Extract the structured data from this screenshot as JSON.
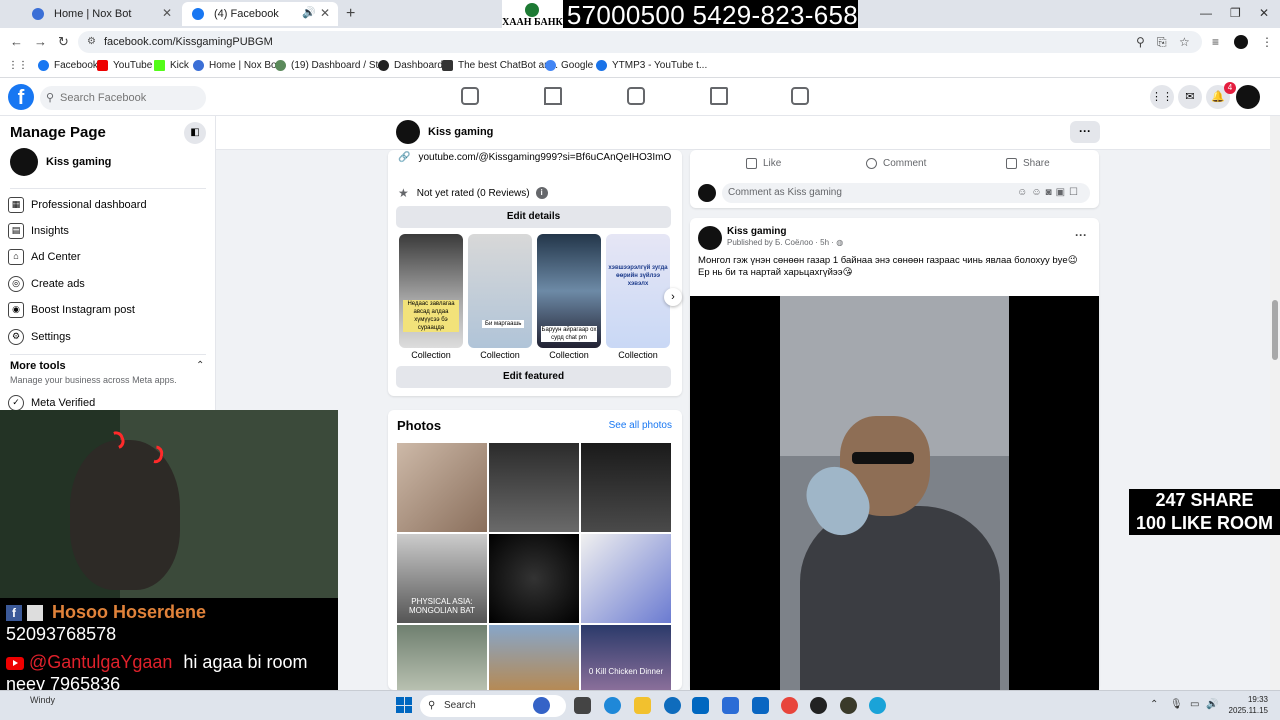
{
  "browser": {
    "tabs": [
      {
        "label": "Home | Nox Bot"
      },
      {
        "label": "(4) Facebook"
      }
    ],
    "url": "facebook.com/KissgamingPUBGM",
    "bookmarks": [
      {
        "label": "Facebook"
      },
      {
        "label": "YouTube"
      },
      {
        "label": "Kick"
      },
      {
        "label": "Home | Nox Bot"
      },
      {
        "label": "(19) Dashboard / Str..."
      },
      {
        "label": "Dashboard"
      },
      {
        "label": "The best ChatBot an..."
      },
      {
        "label": "Google"
      },
      {
        "label": "YTMP3 - YouTube t..."
      }
    ]
  },
  "bank_overlay": {
    "bank_name": "ХААН БАНК",
    "phones": "57000500 5429-823-658"
  },
  "fb": {
    "search_placeholder": "Search Facebook",
    "notification_count": "4"
  },
  "sidebar": {
    "title": "Manage Page",
    "page_name": "Kiss gaming",
    "items": [
      {
        "label": "Professional dashboard"
      },
      {
        "label": "Insights"
      },
      {
        "label": "Ad Center"
      },
      {
        "label": "Create ads"
      },
      {
        "label": "Boost Instagram post"
      },
      {
        "label": "Settings"
      }
    ],
    "more_tools": "More tools",
    "more_tools_sub": "Manage your business across Meta apps.",
    "meta_verified": "Meta Verified"
  },
  "page_header": {
    "name": "Kiss gaming"
  },
  "intro": {
    "link": "youtube.com/@Kissgaming999?si=Bf6uCAnQeIHO3ImO",
    "rating": "Not yet rated (0 Reviews)",
    "edit_details": "Edit details",
    "edit_featured": "Edit featured",
    "stories": [
      {
        "label": "Collection",
        "caption": "Недаас завлагаа авсад алдаа хүмүүсээ бэ сураацда"
      },
      {
        "label": "Collection",
        "caption": "Би маргаашь"
      },
      {
        "label": "Collection",
        "caption": "Баруун айрагаар ох сурд chat pm"
      },
      {
        "label": "Collection",
        "caption": "хэвшээрэлгүй зугда өөрийн зүйлээ хэвэлх"
      }
    ]
  },
  "photos": {
    "title": "Photos",
    "see_all": "See all photos",
    "captions": [
      "",
      "",
      "",
      "PHYSICAL ASIA: MONGOLIAN BAT",
      "",
      "",
      "",
      "",
      "0 Kill Chicken Dinner"
    ]
  },
  "post_actions": {
    "like": "Like",
    "comment": "Comment",
    "share": "Share",
    "comment_placeholder": "Comment as Kiss gaming"
  },
  "post": {
    "author": "Kiss gaming",
    "meta": "Published by Б. Соёлоо · 5h ·",
    "line1": "Монгол гэж үнэн сөнөөн газар 1 байнаа энэ сөнөөн газраас чинь явлаа болохуу bye😉",
    "line2": "Ер нь би та нартай харьцахгүйээ😘"
  },
  "stream": {
    "fb_name": "Hosoo Hoserdene",
    "fb_number": "52093768578",
    "yt_name": "@GantulgaYgaan",
    "yt_message": "hi agaa bi room",
    "yt_message2": "neey 7965836",
    "share_line1": "247 SHARE",
    "share_line2": "100 LIKE ROOM"
  },
  "taskbar": {
    "weather": "Windy",
    "search": "Search",
    "time": "19:33",
    "date": "2025.11.15"
  },
  "colors": {
    "fb_blue": "#1877f2",
    "orange_name": "#e0823a",
    "red_name": "#e0212b"
  }
}
